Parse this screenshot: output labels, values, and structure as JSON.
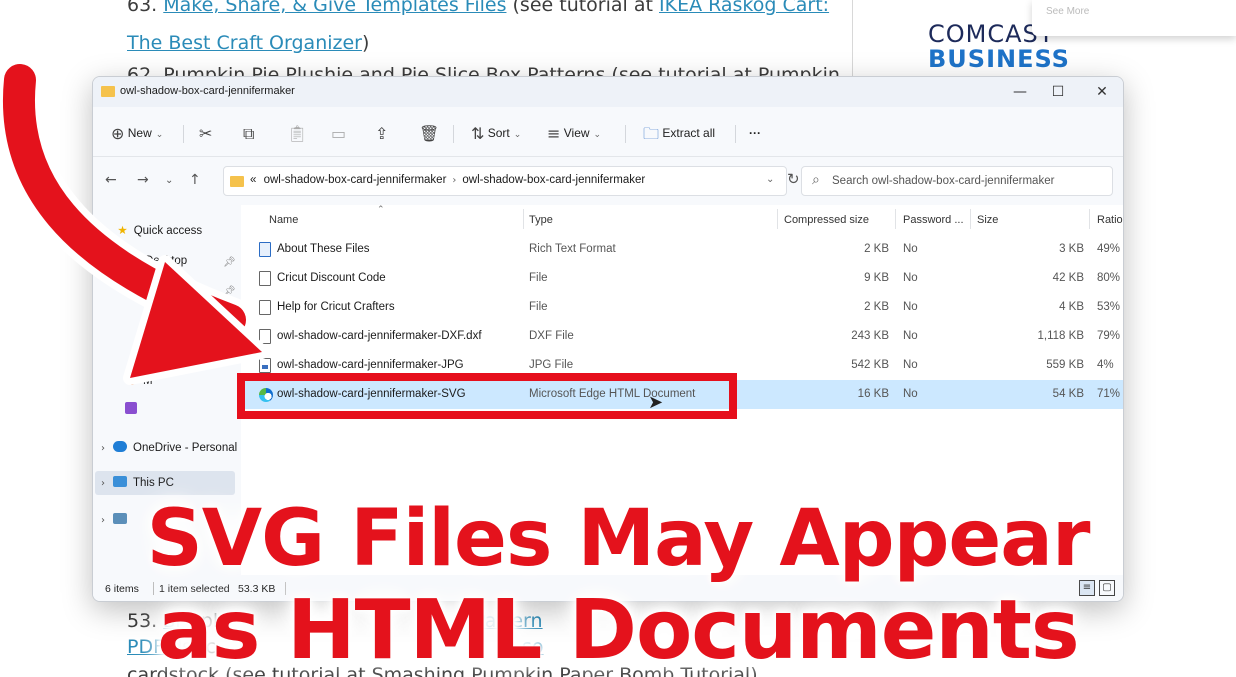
{
  "background_page": {
    "line1_prefix": "63. ",
    "line1_link": "Make, Share, & Give Templates Files",
    "line1_mid": " (see tutorial at ",
    "line1_link2": "IKEA Raskog Cart:",
    "line2_link": "The Best Craft Organizer",
    "line2_suffix": ")",
    "line3": "62. Pumpkin Pie Plushie and Pie Slice Box Patterns (see tutorial at Pumpkin",
    "bottom1_prefix": "53. ",
    "bottom1_link": "Sr",
    "bottom1_mid": "  apl   ",
    "bottom1_link2": "Pattern",
    "bottom2_link": "PDF",
    "bottom2_mid": "       dst     c    ",
    "bottom2_link2": "so",
    "bottom3": "cardstock (see tutorial at Smashing Pumpkin Paper Bomb Tutorial)",
    "ad_line1": "COMCAST",
    "ad_line2": "BUSINESS",
    "popup_text": "See More"
  },
  "window": {
    "title": "owl-shadow-box-card-jennifermaker",
    "minimize": "—",
    "maximize": "☐",
    "close": "✕"
  },
  "toolbar": {
    "new_label": "New",
    "sort_label": "Sort",
    "view_label": "View",
    "extract_label": "Extract all",
    "more_label": "···"
  },
  "address": {
    "crumb_prefix": "«",
    "crumb1": "owl-shadow-box-card-jennifermaker",
    "crumb2": "owl-shadow-box-card-jennifermaker",
    "search_placeholder": "Search owl-shadow-box-card-jennifermaker"
  },
  "navpane": {
    "quick_access": "Quick access",
    "desktop": "Desktop",
    "downloads": "loads",
    "music": "M",
    "onedrive": "OneDrive - Personal",
    "this_pc": "This PC"
  },
  "columns": {
    "name": "Name",
    "type": "Type",
    "compressed": "Compressed size",
    "password": "Password ...",
    "size": "Size",
    "ratio": "Ratio"
  },
  "files": [
    {
      "name": "About These Files",
      "type": "Rich Text Format",
      "compressed": "2 KB",
      "password": "No",
      "size": "3 KB",
      "ratio": "49%"
    },
    {
      "name": "Cricut Discount Code",
      "type": "File",
      "compressed": "9 KB",
      "password": "No",
      "size": "42 KB",
      "ratio": "80%"
    },
    {
      "name": "Help for Cricut Crafters",
      "type": "File",
      "compressed": "2 KB",
      "password": "No",
      "size": "4 KB",
      "ratio": "53%"
    },
    {
      "name": "owl-shadow-card-jennifermaker-DXF.dxf",
      "type": "DXF File",
      "compressed": "243 KB",
      "password": "No",
      "size": "1,118 KB",
      "ratio": "79%"
    },
    {
      "name": "owl-shadow-card-jennifermaker-JPG",
      "type": "JPG File",
      "compressed": "542 KB",
      "password": "No",
      "size": "559 KB",
      "ratio": "4%"
    },
    {
      "name": "owl-shadow-card-jennifermaker-SVG",
      "type": "Microsoft Edge HTML Document",
      "compressed": "16 KB",
      "password": "No",
      "size": "54 KB",
      "ratio": "71%"
    }
  ],
  "status": {
    "count": "6 items",
    "selected": "1 item selected",
    "selected_size": "53.3 KB"
  },
  "caption": {
    "line1": "SVG Files May Appear",
    "line2": "as HTML Documents"
  },
  "colors": {
    "accent_red": "#e4121c",
    "selection_blue": "#cce8ff",
    "link_blue": "#2a8bb8"
  }
}
